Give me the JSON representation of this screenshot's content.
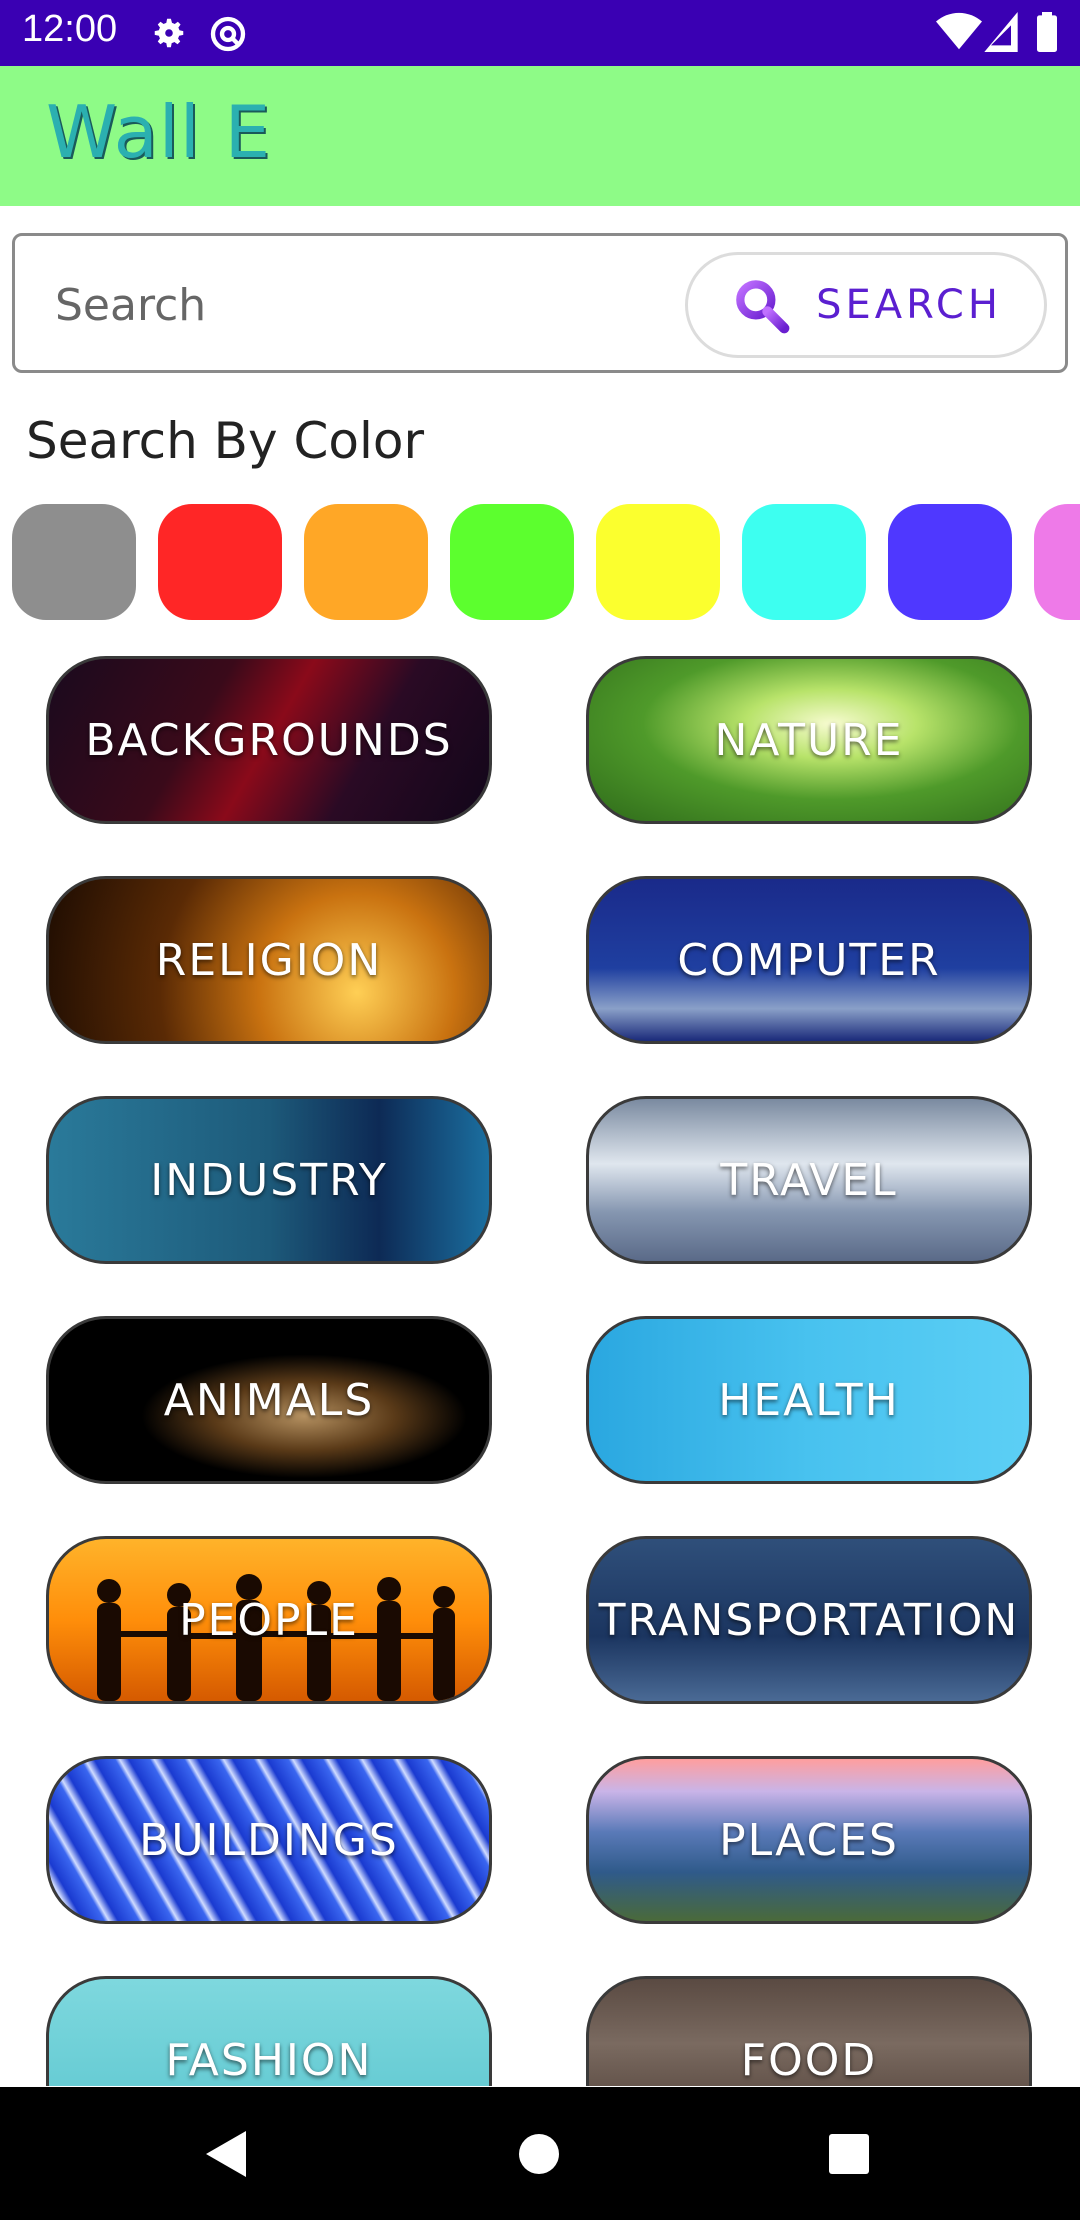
{
  "status_bar": {
    "time": "12:00",
    "icons": [
      "gear-icon",
      "at-sign-icon",
      "wifi-icon",
      "signal-icon",
      "battery-icon"
    ],
    "background": "#3a00b3"
  },
  "app_bar": {
    "title": "Wall E",
    "background": "#8efb87",
    "title_color": "#2bb0b0"
  },
  "search": {
    "placeholder": "Search",
    "value": "",
    "button_label": "SEARCH",
    "button_icon": "magnifier-icon",
    "accent": "#5b1fd0"
  },
  "color_section": {
    "title": "Search By Color",
    "swatches": [
      {
        "name": "gray",
        "color": "#8e8e8e"
      },
      {
        "name": "red",
        "color": "#ff2626"
      },
      {
        "name": "orange",
        "color": "#ffa726"
      },
      {
        "name": "green",
        "color": "#5cff2e"
      },
      {
        "name": "yellow",
        "color": "#fbff2e"
      },
      {
        "name": "cyan",
        "color": "#3dfff0"
      },
      {
        "name": "blue",
        "color": "#4f38ff"
      },
      {
        "name": "pink",
        "color": "#ee7ae8"
      }
    ]
  },
  "categories": [
    {
      "label": "BACKGROUNDS"
    },
    {
      "label": "NATURE"
    },
    {
      "label": "RELIGION"
    },
    {
      "label": "COMPUTER"
    },
    {
      "label": "INDUSTRY"
    },
    {
      "label": "TRAVEL"
    },
    {
      "label": "ANIMALS"
    },
    {
      "label": "HEALTH"
    },
    {
      "label": "PEOPLE"
    },
    {
      "label": "TRANSPORTATION"
    },
    {
      "label": "BUILDINGS"
    },
    {
      "label": "PLACES"
    },
    {
      "label": "FASHION"
    },
    {
      "label": "FOOD"
    }
  ],
  "nav_bar": {
    "buttons": [
      "back-icon",
      "home-icon",
      "recents-icon"
    ]
  }
}
